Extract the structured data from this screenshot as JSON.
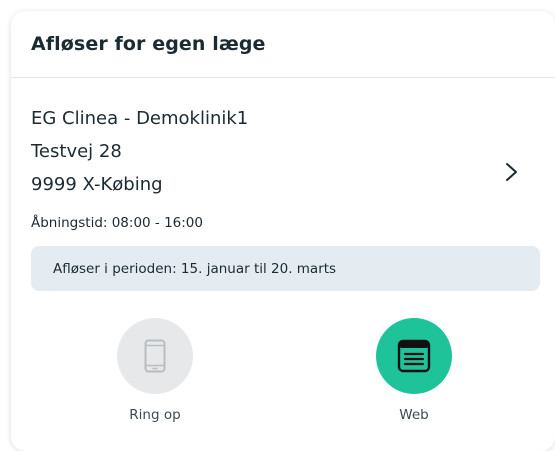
{
  "header": {
    "title": "Afløser for egen læge"
  },
  "clinic": {
    "name": "EG Clinea - Demoklinik1",
    "street": "Testvej 28",
    "city": "9999 X-Købing",
    "opening_hours": "Åbningstid: 08:00 - 16:00"
  },
  "period": {
    "text": "Afløser i perioden: 15. januar til 20. marts"
  },
  "actions": {
    "call": {
      "label": "Ring op",
      "icon": "phone-icon",
      "color": "#e6e8ea",
      "enabled": false
    },
    "web": {
      "label": "Web",
      "icon": "web-page-icon",
      "color": "#1fc39a",
      "enabled": true
    }
  }
}
